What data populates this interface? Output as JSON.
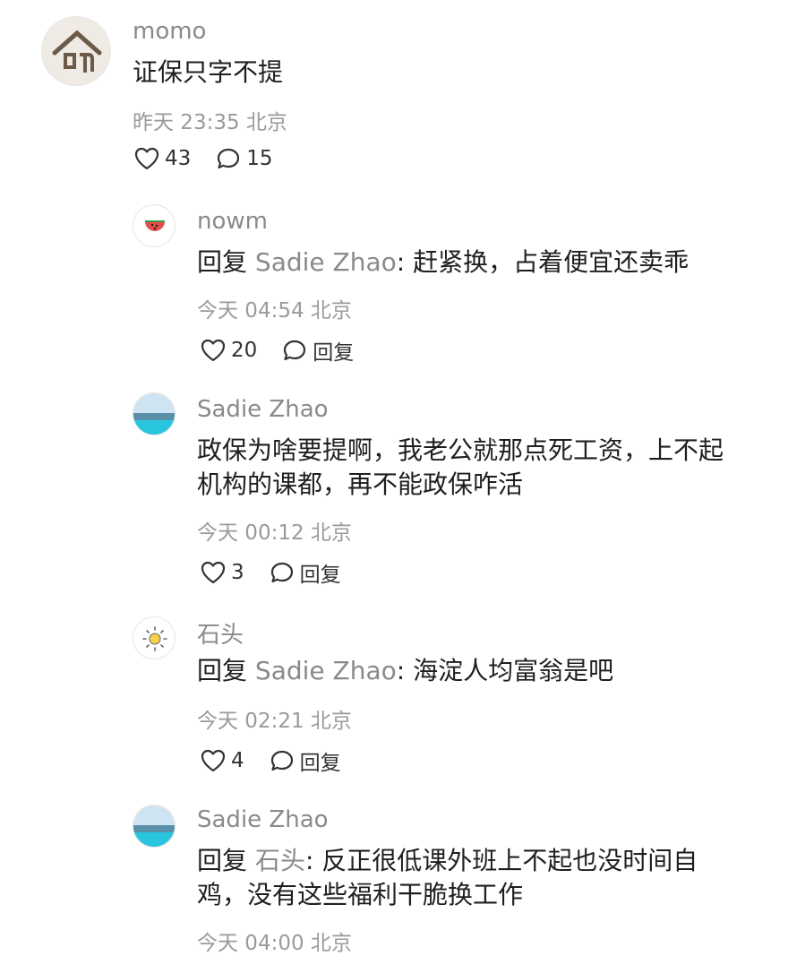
{
  "comments": [
    {
      "username": "momo",
      "text": "证保只字不提",
      "time": "昨天 23:35",
      "location": "北京",
      "likes": "43",
      "replies": "15"
    },
    {
      "username": "nowm",
      "reply_prefix": "回复",
      "reply_target": "Sadie Zhao",
      "text": ": 赶紧换，占着便宜还卖乖",
      "time": "今天 04:54",
      "location": "北京",
      "likes": "20",
      "reply_label": "回复"
    },
    {
      "username": "Sadie Zhao",
      "text": "政保为啥要提啊，我老公就那点死工资，上不起机构的课都，再不能政保咋活",
      "time": "今天 00:12",
      "location": "北京",
      "likes": "3",
      "reply_label": "回复"
    },
    {
      "username": "石头",
      "reply_prefix": "回复",
      "reply_target": "Sadie Zhao",
      "text": ": 海淀人均富翁是吧",
      "time": "今天 02:21",
      "location": "北京",
      "likes": "4",
      "reply_label": "回复"
    },
    {
      "username": "Sadie Zhao",
      "reply_prefix": "回复",
      "reply_target": "石头",
      "text": ": 反正很低课外班上不起也没时间自鸡，没有这些福利干脆换工作",
      "time": "今天 04:00",
      "location": "北京"
    }
  ]
}
